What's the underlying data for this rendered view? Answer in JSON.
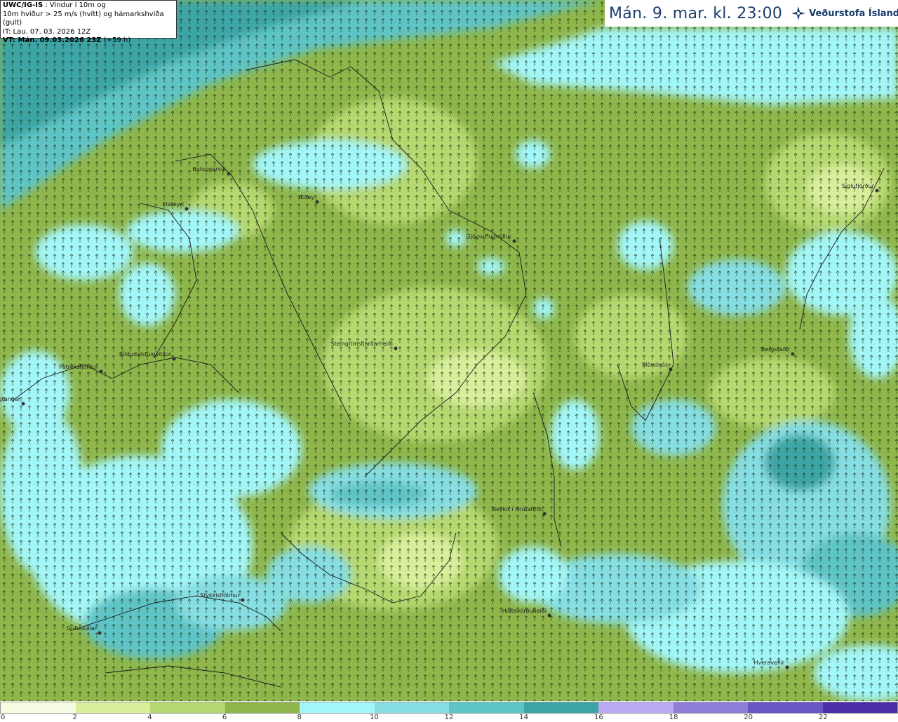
{
  "info": {
    "model": "UWC/IG-IS",
    "desc1": " : Vindur í 10m og",
    "desc2": "10m hviður > 25 m/s (hvítt) og hámarkshviða (gult)",
    "it": "IT: Lau. 07. 03. 2026 12Z",
    "vt_label": "VT: Mán. 09.03.2026 23Z",
    "vt_lead": " (+59 h)"
  },
  "title": {
    "date": "Mán. 9. mar. kl. 23:00",
    "logo_text": "Veðurstofa Íslands",
    "logo_icon": "snowflake-star-icon"
  },
  "places": [
    {
      "name": "Bolungarvík",
      "lon": 326,
      "lat": 248
    },
    {
      "name": "Flateyri",
      "lon": 266,
      "lat": 298
    },
    {
      "name": "Æðey",
      "lon": 452,
      "lat": 288
    },
    {
      "name": "Gjögurflugvöllur",
      "lon": 733,
      "lat": 344
    },
    {
      "name": "Steingrímsfjarðarheiði",
      "lon": 564,
      "lat": 497
    },
    {
      "name": "Bíldudalsflugvöllur",
      "lon": 248,
      "lat": 512
    },
    {
      "name": "Patreksfjörður",
      "lon": 144,
      "lat": 530
    },
    {
      "name": "Bjargtangar",
      "lon": 33,
      "lat": 576
    },
    {
      "name": "Blönduós",
      "lon": 956,
      "lat": 527
    },
    {
      "name": "Bergstaðir",
      "lon": 1130,
      "lat": 505
    },
    {
      "name": "Siglufjörður",
      "lon": 1250,
      "lat": 272
    },
    {
      "name": "Reykir í Hrútafirði",
      "lon": 776,
      "lat": 733
    },
    {
      "name": "Stykkishólmur",
      "lon": 346,
      "lat": 856
    },
    {
      "name": "Holtavörðuheiði",
      "lon": 783,
      "lat": 878
    },
    {
      "name": "Gufuskálar",
      "lon": 142,
      "lat": 903
    },
    {
      "name": "Hveravellir",
      "lon": 1122,
      "lat": 952
    }
  ],
  "legend": {
    "colors": [
      "#f6fce2",
      "#d8ee9a",
      "#b6d870",
      "#8eb64b",
      "#a3f6f8",
      "#86dee2",
      "#5fc4c6",
      "#3ea5a6",
      "#bbaaf2",
      "#8f7ed8",
      "#6a55c4",
      "#4a2ea8"
    ],
    "ticks": [
      "0",
      "2",
      "4",
      "6",
      "8",
      "10",
      "12",
      "14",
      "16",
      "18",
      "20",
      "22"
    ]
  }
}
